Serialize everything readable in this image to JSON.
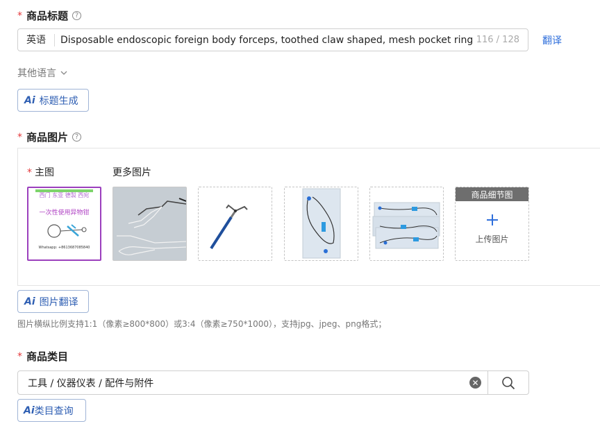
{
  "title_section": {
    "label": "商品标题",
    "required_mark": "*",
    "help": "?",
    "language": "英语",
    "value": "Disposable endoscopic foreign body forceps, toothed claw shaped, mesh pocket ring, f",
    "counter": "116 / 128",
    "translate_link": "翻译",
    "other_languages": "其他语言",
    "ai_button": "标题生成"
  },
  "images_section": {
    "label": "商品图片",
    "required_mark": "*",
    "help": "?",
    "main_label": "主图",
    "more_label": "更多图片",
    "main_image_text": {
      "line1": "西门 东亚 德製 西宛",
      "line2": "一次性使用异物钳",
      "line3": "Whatsapp: +8613687085840"
    },
    "detail_tab": "商品细节图",
    "upload_label": "上传图片",
    "ai_button": "图片翻译",
    "hint": "图片横纵比例支持1:1（像素≥800*800）或3:4（像素≥750*1000），支持jpg、jpeg、png格式；"
  },
  "category_section": {
    "label": "商品类目",
    "required_mark": "*",
    "value": "工具 / 仪器仪表 / 配件与附件",
    "ai_button": "类目查询"
  },
  "ai_logo_text": "Ai",
  "colors": {
    "accent": "#2f6fdb",
    "required": "#e4393c",
    "main_image_border": "#9b3fbd"
  }
}
